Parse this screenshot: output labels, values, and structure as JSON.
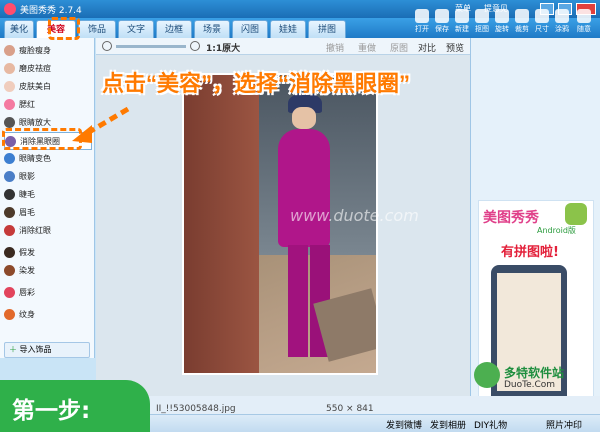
{
  "window": {
    "title": "美图秀秀 2.7.4",
    "menu": "菜单",
    "feedback": "提意见"
  },
  "tabs": [
    "美化",
    "美容",
    "饰品",
    "文字",
    "边框",
    "场景",
    "闪图",
    "娃娃",
    "拼图"
  ],
  "tools": [
    "打开",
    "保存",
    "新建",
    "抠图",
    "旋转",
    "裁剪",
    "尺寸",
    "涂鸦",
    "随意"
  ],
  "sidebar": {
    "items": [
      "瘦脸瘦身",
      "磨皮祛痘",
      "皮肤美白",
      "腮红",
      "眼睛放大",
      "消除黑眼圈",
      "眼睛变色",
      "眼影",
      "睫毛",
      "眉毛",
      "消除红眼",
      "假发",
      "染发",
      "唇彩",
      "纹身"
    ],
    "import_button": "导入饰品"
  },
  "canvas_toolbar": {
    "zoom": "1:1原大",
    "undo": "撤销",
    "redo": "重做",
    "original": "原图",
    "compare": "对比",
    "preview": "预览"
  },
  "callout": {
    "instruction": "点击“美容”，选择“消除黑眼圈”",
    "step": "第一步:"
  },
  "watermark": {
    "site": "www.duote.com"
  },
  "ad": {
    "brand": "美图秀秀",
    "platform": "Android版",
    "tagline": "有拼图啦!"
  },
  "status": {
    "filename": "II_!!53005848.jpg",
    "size": "550 × 841"
  },
  "bottombar": {
    "weibo": "发到微博",
    "album": "发到相册",
    "gift": "DIY礼物",
    "print": "照片冲印"
  },
  "logo": {
    "name": "多特软件站",
    "url": "DuoTe.Com"
  }
}
